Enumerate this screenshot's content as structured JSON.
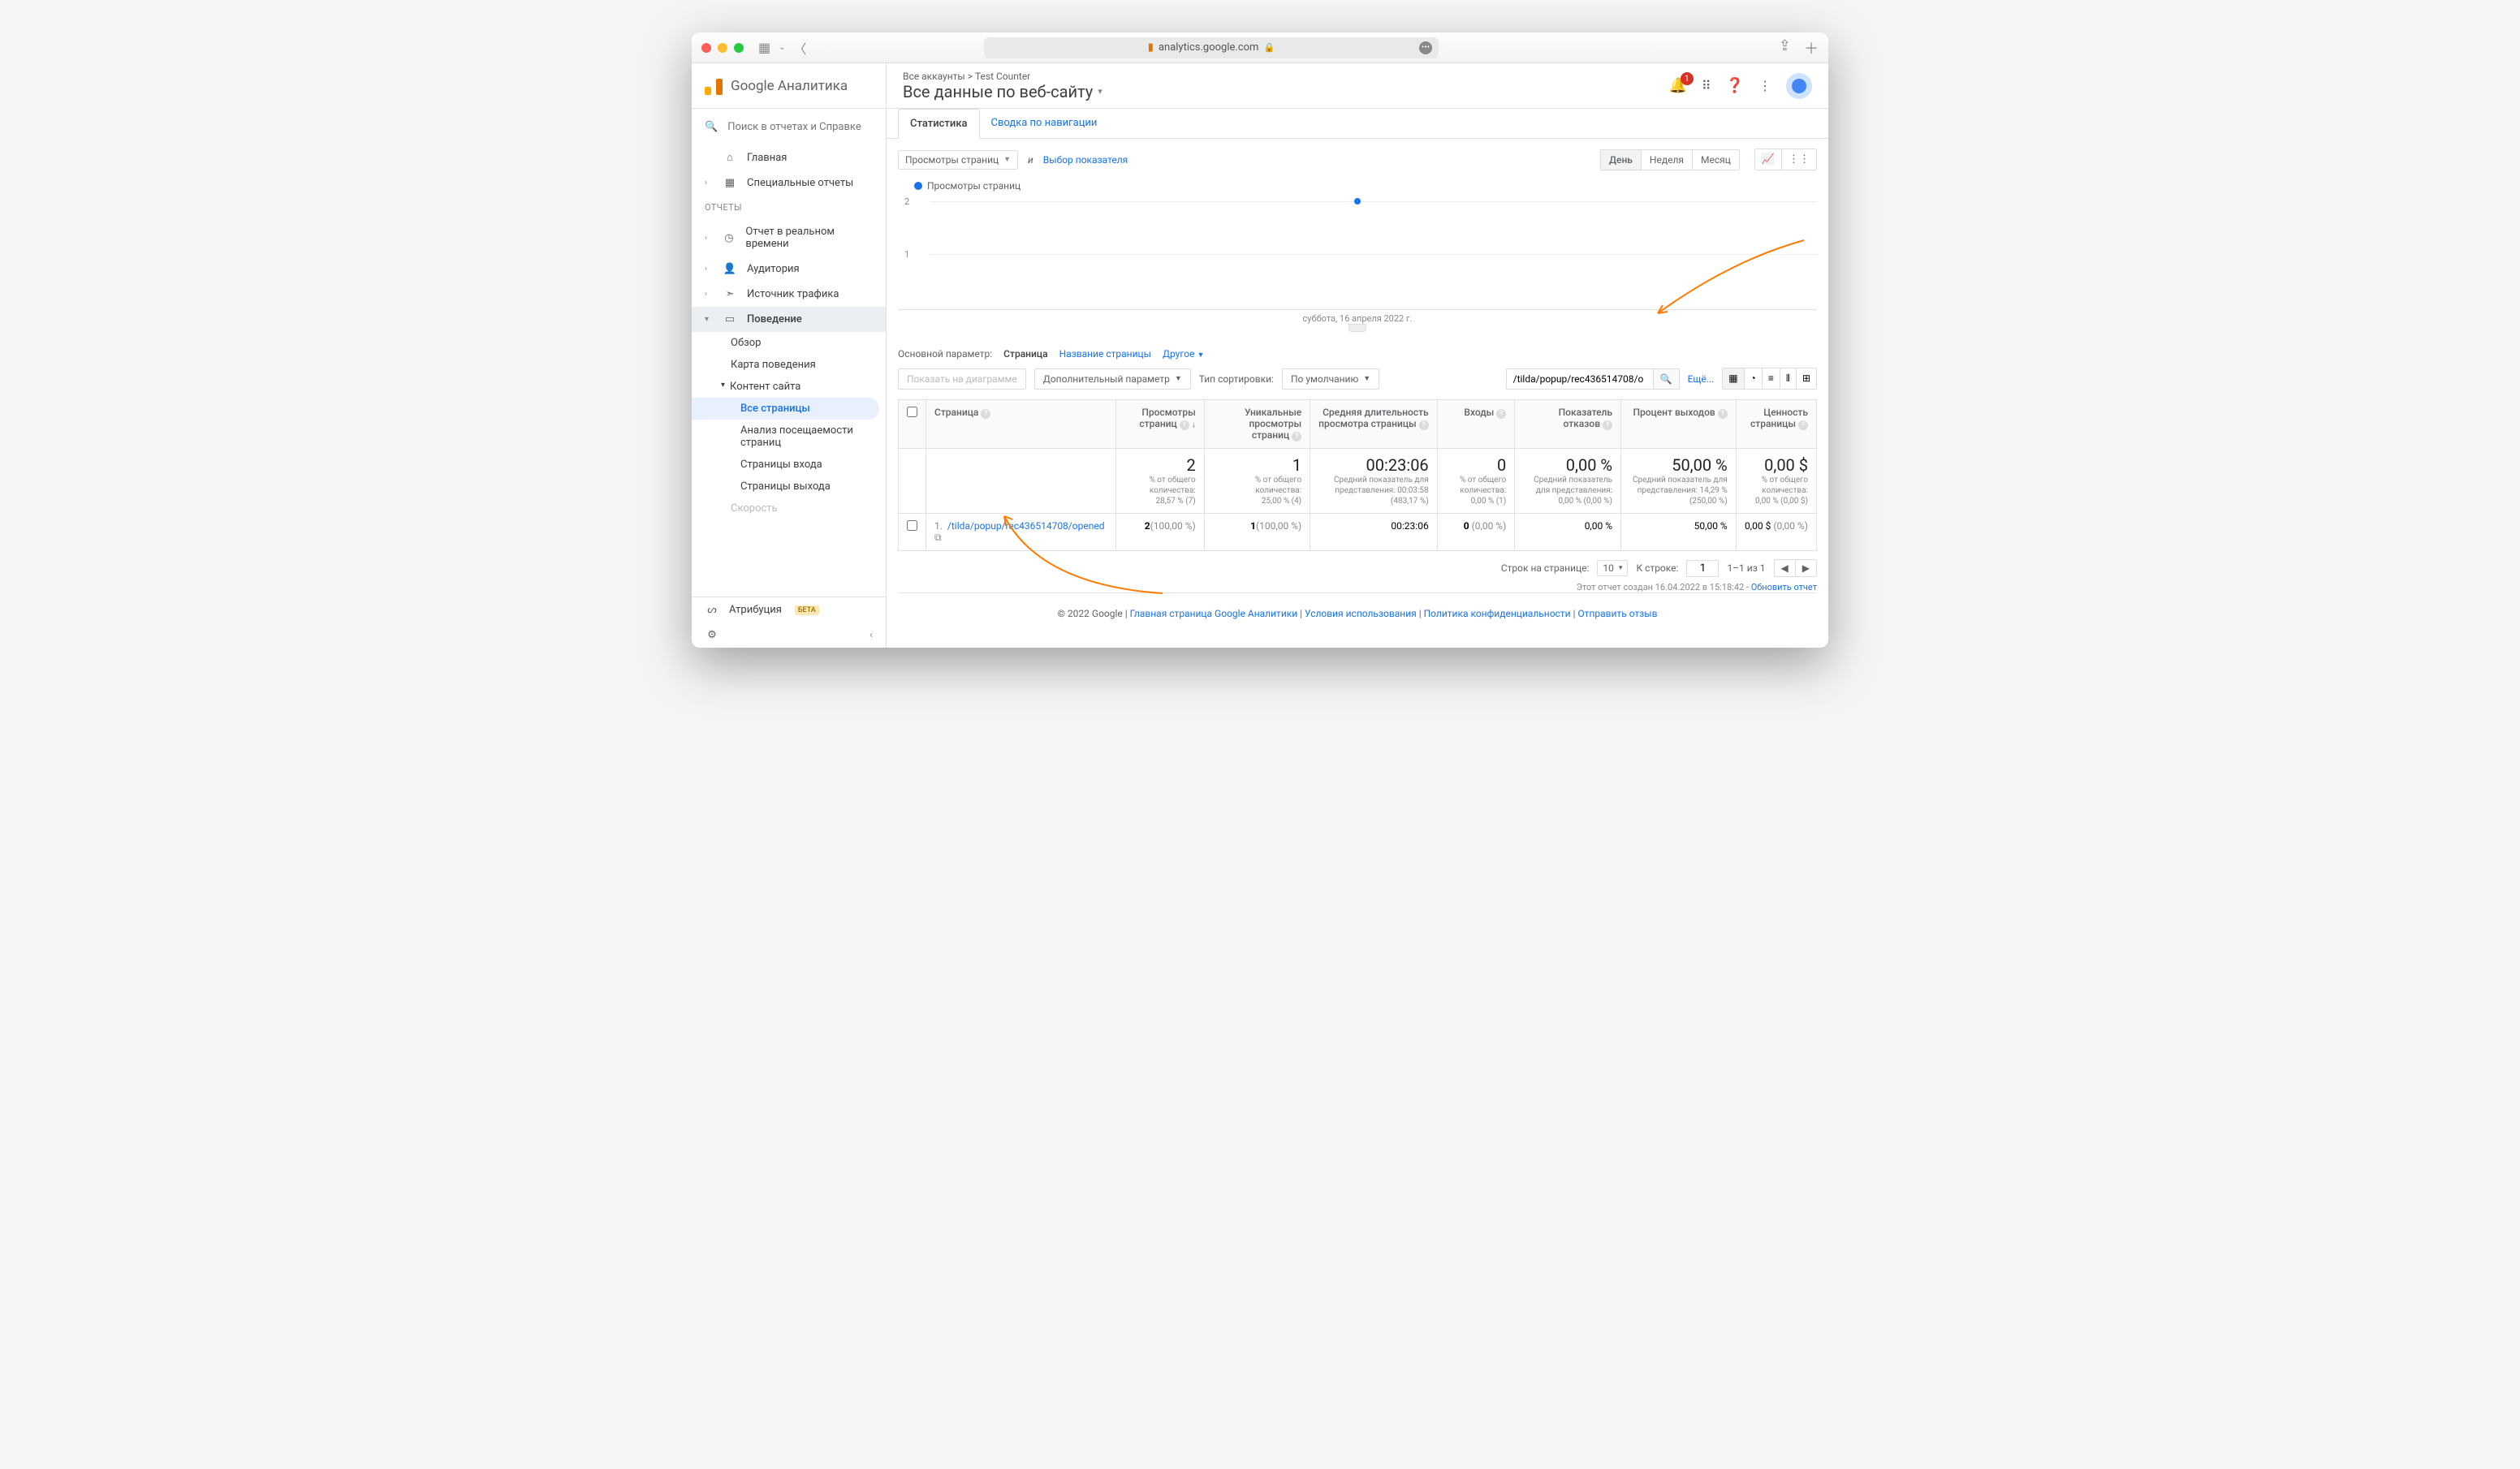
{
  "url": "analytics.google.com",
  "logo_text": "Google Аналитика",
  "search_placeholder": "Поиск в отчетах и Справке",
  "breadcrumb": "Все аккаунты > Test Counter",
  "view_title": "Все данные по веб-сайту",
  "notif_count": "1",
  "nav": {
    "home": "Главная",
    "custom": "Специальные отчеты",
    "section": "ОТЧЕТЫ",
    "realtime": "Отчет в реальном времени",
    "audience": "Аудитория",
    "acquisition": "Источник трафика",
    "behavior": "Поведение",
    "overview": "Обзор",
    "behavior_flow": "Карта поведения",
    "site_content": "Контент сайта",
    "all_pages": "Все страницы",
    "content_drill": "Анализ посещаемости страниц",
    "landing": "Страницы входа",
    "exit": "Страницы выхода",
    "speed": "Скорость",
    "attribution": "Атрибуция",
    "beta": "БЕТА"
  },
  "tabs": {
    "explorer": "Статистика",
    "nav_summary": "Сводка по навигации"
  },
  "metrics": {
    "selected": "Просмотры страниц",
    "and": "и",
    "choose": "Выбор показателя",
    "legend": "Просмотры страниц"
  },
  "range": {
    "day": "День",
    "week": "Неделя",
    "month": "Месяц"
  },
  "chart": {
    "y2": "2",
    "y1": "1",
    "xlabel": "суббота, 16 апреля 2022 г."
  },
  "dims": {
    "label": "Основной параметр:",
    "page": "Страница",
    "title": "Название страницы",
    "other": "Другое"
  },
  "filters": {
    "plot_rows": "Показать на диаграмме",
    "secondary": "Дополнительный параметр",
    "sort_label": "Тип сортировки:",
    "sort_value": "По умолчанию",
    "search_value": "/tilda/popup/rec436514708/o",
    "advanced": "Ещё..."
  },
  "cols": {
    "page": "Страница",
    "pageviews": "Просмотры страниц",
    "unique": "Уникальные просмотры страниц",
    "avg_time": "Средняя длительность просмотра страницы",
    "entrances": "Входы",
    "bounce": "Показатель отказов",
    "exit_pct": "Процент выходов",
    "value": "Ценность страницы"
  },
  "summary": {
    "pv": {
      "v": "2",
      "s1": "% от общего количества:",
      "s2": "28,57 % (7)"
    },
    "uv": {
      "v": "1",
      "s1": "% от общего количества:",
      "s2": "25,00 % (4)"
    },
    "at": {
      "v": "00:23:06",
      "s1": "Средний показатель для представления: 00:03:58",
      "s2": "(483,17 %)"
    },
    "en": {
      "v": "0",
      "s1": "% от общего количества:",
      "s2": "0,00 % (1)"
    },
    "bn": {
      "v": "0,00 %",
      "s1": "Средний показатель для представления:",
      "s2": "0,00 % (0,00 %)"
    },
    "ex": {
      "v": "50,00 %",
      "s1": "Средний показатель для представления: 14,29 %",
      "s2": "(250,00 %)"
    },
    "pvw": {
      "v": "0,00 $",
      "s1": "% от общего количества:",
      "s2": "0,00 % (0,00 $)"
    }
  },
  "row1": {
    "idx": "1.",
    "path": "/tilda/popup/rec436514708/opened",
    "pv": "2",
    "pv_pct": "(100,00 %)",
    "uv": "1",
    "uv_pct": "(100,00 %)",
    "at": "00:23:06",
    "en": "0",
    "en_pct": "(0,00 %)",
    "bn": "0,00 %",
    "ex": "50,00 %",
    "pvw": "0,00 $",
    "pvw_pct": "(0,00 %)"
  },
  "table_footer": {
    "rows_label": "Строк на странице:",
    "rows_value": "10",
    "goto_label": "К строке:",
    "goto_value": "1",
    "range": "1–1 из 1"
  },
  "report_gen": {
    "text": "Этот отчет создан 16.04.2022 в 15:18:42",
    "refresh": "Обновить отчет"
  },
  "footer": {
    "copy": "© 2022 Google",
    "home": "Главная страница Google Аналитики",
    "terms": "Условия использования",
    "privacy": "Политика конфиденциальности",
    "feedback": "Отправить отзыв"
  }
}
